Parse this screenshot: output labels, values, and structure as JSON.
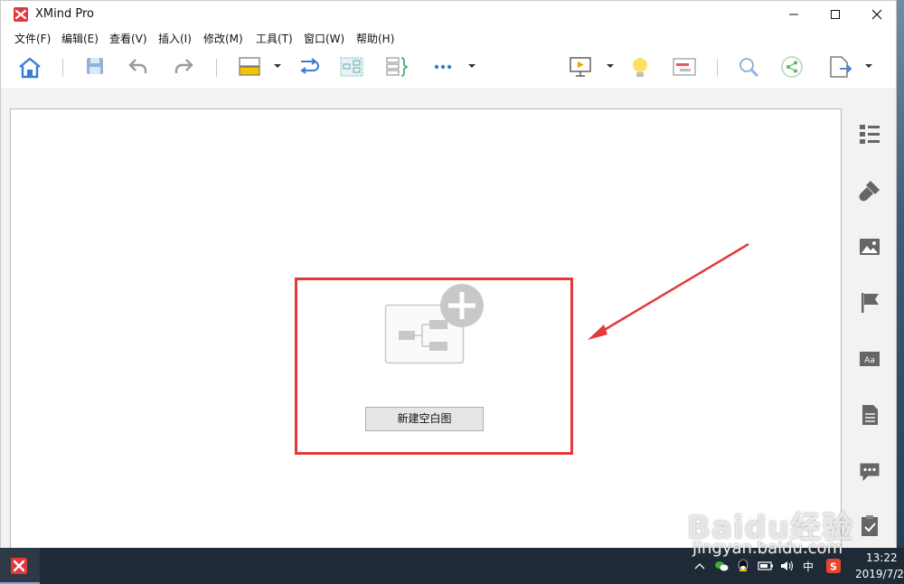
{
  "window": {
    "title": "XMind Pro"
  },
  "menubar": {
    "items": [
      {
        "label": "文件(F)"
      },
      {
        "label": "编辑(E)"
      },
      {
        "label": "查看(V)"
      },
      {
        "label": "插入(I)"
      },
      {
        "label": "修改(M)"
      },
      {
        "label": "工具(T)"
      },
      {
        "label": "窗口(W)"
      },
      {
        "label": "帮助(H)"
      }
    ]
  },
  "toolbar": {
    "icons": [
      "home-icon",
      "save-icon",
      "undo-icon",
      "redo-icon",
      "topic-icon",
      "relationship-icon",
      "boundary-icon",
      "summary-icon",
      "more-icon",
      "presentation-icon",
      "brainstorm-icon",
      "gantt-icon",
      "search-icon",
      "share-icon",
      "export-icon"
    ]
  },
  "right_panel": {
    "icons": [
      "outline-icon",
      "format-icon",
      "image-icon",
      "marker-icon",
      "text-icon",
      "notes-icon",
      "comments-icon",
      "task-icon"
    ]
  },
  "canvas": {
    "new_blank_button": "新建空白图"
  },
  "taskbar": {
    "tray_ime": "中",
    "clock_time": "13:22",
    "clock_date": "2019/7/2"
  },
  "watermark": {
    "brand": "Baidu经验",
    "url": "jingyan.baidu.com"
  },
  "colors": {
    "highlight": "#e23a3a",
    "accent_blue": "#3a7bd5",
    "app_red": "#e0383e"
  }
}
